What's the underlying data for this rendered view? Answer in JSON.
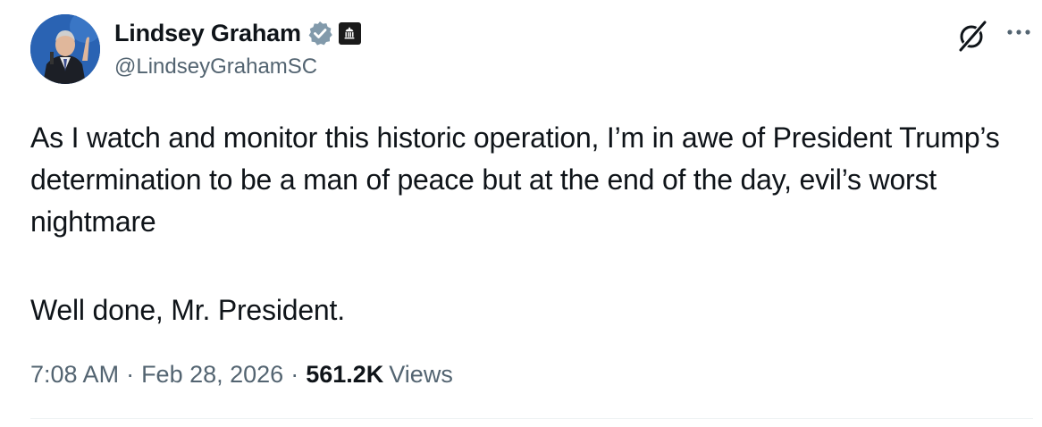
{
  "author": {
    "display_name": "Lindsey Graham",
    "handle": "@LindseyGrahamSC",
    "verified_badge_icon": "verified-checkmark-icon",
    "affiliation_badge_icon": "government-building-icon",
    "verified_color": "#829aab"
  },
  "tweet": {
    "paragraph_1": "As I watch and monitor this historic operation, I’m in awe of President Trump’s determination to be a man of peace but at the end of the day, evil’s worst nightmare",
    "paragraph_2": "Well done, Mr. President."
  },
  "meta": {
    "time": "7:08 AM",
    "separator_1": "·",
    "date": "Feb 28, 2026",
    "separator_2": "·",
    "views_count": "561.2K",
    "views_label": "Views"
  },
  "actions": {
    "grok_icon": "grok-icon",
    "more_icon": "more-options-icon"
  },
  "colors": {
    "text_primary": "#0f1419",
    "text_secondary": "#536471"
  }
}
